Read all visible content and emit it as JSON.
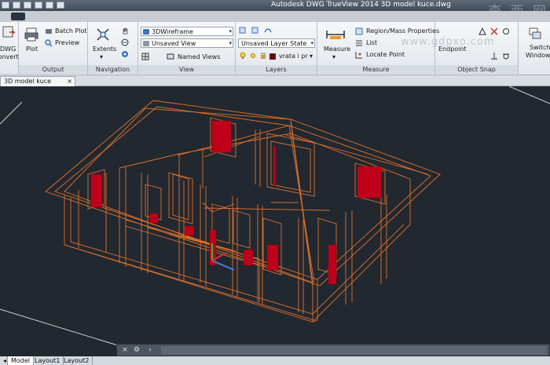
{
  "window": {
    "title": "Autodesk DWG TrueView 2014    3D model kuce.dwg"
  },
  "watermark": "查 西 网",
  "watermark2": "www.gdpxo.com",
  "ribbon": {
    "convert": {
      "line1": "DWG",
      "line2": "Convert"
    },
    "output": {
      "label": "Output",
      "plot": "Plot",
      "batch_plot": "Batch Plot",
      "preview": "Preview"
    },
    "navigation": {
      "label": "Navigation",
      "extents": "Extents"
    },
    "view": {
      "label": "View",
      "visual_style": "3DWireframe",
      "saved_view": "Unsaved View",
      "named_views": "Named Views"
    },
    "layers": {
      "label": "Layers",
      "layer_state": "Unsaved Layer State",
      "current_layer": "vrata i pr",
      "layer_color": "#7a0000"
    },
    "measure": {
      "label": "Measure",
      "measure_btn": "Measure",
      "region_mass": "Region/Mass Properties",
      "list": "List",
      "locate_point": "Locate Point"
    },
    "object_snap": {
      "label": "Object Snap",
      "endpoint": "Endpoint"
    },
    "switch_windows": {
      "line1": "Switch",
      "line2": "Windows"
    }
  },
  "document_tab": {
    "label": "3D model kuce"
  },
  "layout_tabs": [
    "Model",
    "Layout1",
    "Layout2"
  ],
  "colors": {
    "background": "#212830",
    "wire": "#e0702a",
    "door": "#c0001a"
  }
}
